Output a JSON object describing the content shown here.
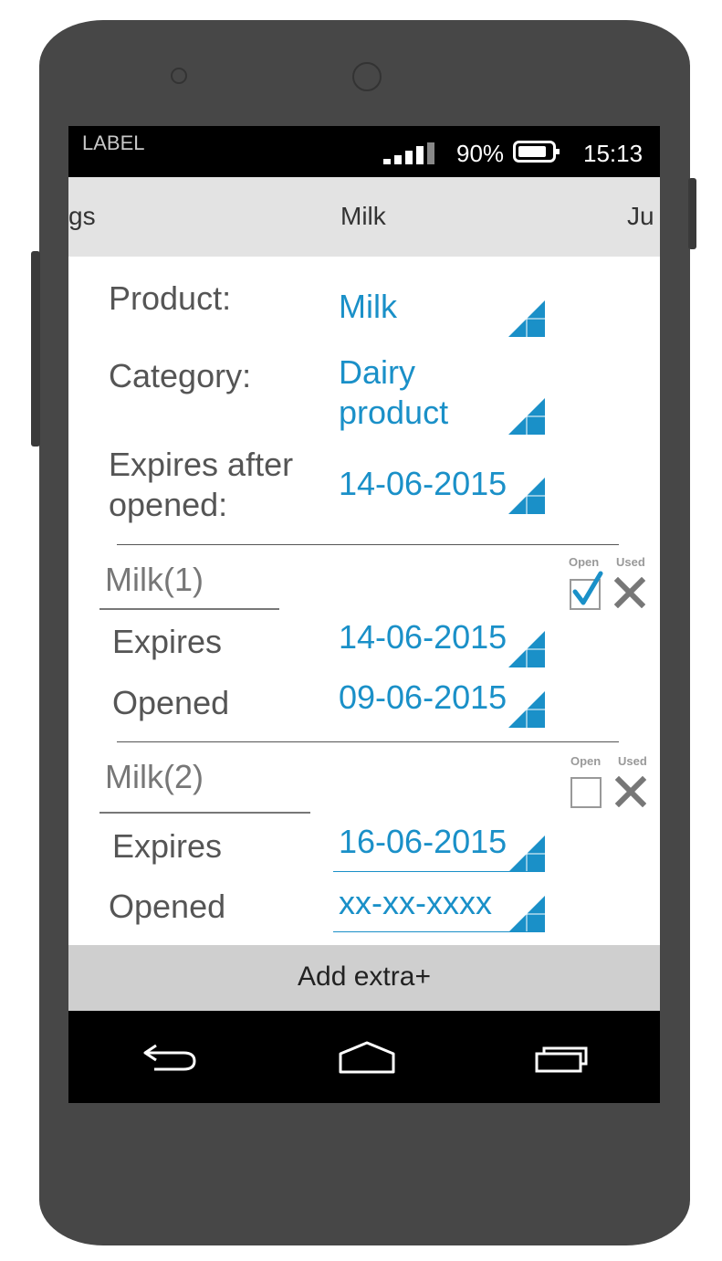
{
  "status_bar": {
    "label": "LABEL",
    "battery_percent": "90%",
    "time": "15:13"
  },
  "tabs": [
    {
      "label": "gs"
    },
    {
      "label": "Milk"
    },
    {
      "label": "Ju"
    }
  ],
  "product_form": {
    "product_label": "Product:",
    "product_value": "Milk",
    "category_label": "Category:",
    "category_value_line1": "Dairy",
    "category_value_line2": "product",
    "expires_label_line1": "Expires after",
    "expires_label_line2": "opened:",
    "expires_value": "14-06-2015"
  },
  "items": [
    {
      "title": "Milk(1)",
      "open_label": "Open",
      "used_label": "Used",
      "open_checked": true,
      "expires_label": "Expires",
      "expires_value": "14-06-2015",
      "opened_label": "Opened",
      "opened_value": "09-06-2015"
    },
    {
      "title": "Milk(2)",
      "open_label": "Open",
      "used_label": "Used",
      "open_checked": false,
      "expires_label": "Expires",
      "expires_value": "16-06-2015",
      "opened_label": "Opened",
      "opened_value": "xx-xx-xxxx"
    }
  ],
  "footer": {
    "add_label": "Add extra+"
  },
  "icons": {
    "back": "back-icon",
    "home": "home-icon",
    "recents": "recents-icon",
    "close": "close-icon",
    "check": "check-icon",
    "dropdown": "dropdown-triangle-icon"
  },
  "colors": {
    "accent": "#1a90c8",
    "phone_body": "#474747",
    "tab_bar": "#e3e3e3",
    "add_bar": "#cfcfcf"
  }
}
